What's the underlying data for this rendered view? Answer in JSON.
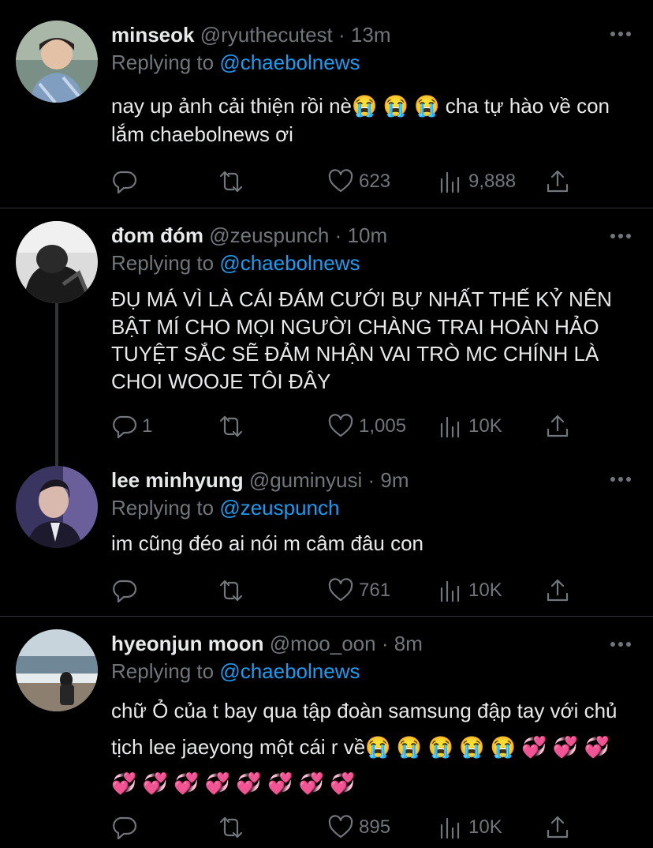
{
  "tweets": [
    {
      "name": "minseok",
      "handle": "@ryuthecutest",
      "time": "13m",
      "replying_label": "Replying to",
      "replying_to": "@chaebolnews",
      "text": "nay up ảnh cải thiện rồi nè😭 😭 😭  cha tự hào về con lắm chaebolnews ơi",
      "replies": "",
      "likes": "623",
      "views": "9,888"
    },
    {
      "name": "đom đóm",
      "handle": "@zeuspunch",
      "time": "10m",
      "replying_label": "Replying to",
      "replying_to": "@chaebolnews",
      "text": "ĐỤ MÁ VÌ LÀ CÁI ĐÁM CƯỚI BỰ NHẤT THẾ KỶ NÊN BẬT MÍ CHO MỌI NGƯỜI CHÀNG TRAI HOÀN HẢO TUYỆT SẮC SẼ ĐẢM NHẬN VAI TRÒ MC CHÍNH LÀ CHOI WOOJE TÔI ĐÂY",
      "replies": "1",
      "likes": "1,005",
      "views": "10K"
    },
    {
      "name": "lee minhyung",
      "handle": "@guminyusi",
      "time": "9m",
      "replying_label": "Replying to",
      "replying_to": "@zeuspunch",
      "text": "im cũng đéo ai nói m câm đâu con",
      "replies": "",
      "likes": "761",
      "views": "10K"
    },
    {
      "name": "hyeonjun moon",
      "handle": "@moo_oon",
      "time": "8m",
      "replying_label": "Replying to",
      "replying_to": "@chaebolnews",
      "text": "chữ Ỏ của t bay qua tập đoàn samsung đập tay với chủ tịch lee jaeyong một cái r về😭 😭 😭 😭 😭 💞 💞 💞 💞 💞 💞 💞 💞 💞 💞 💞",
      "replies": "",
      "likes": "895",
      "views": "10K"
    }
  ],
  "separator": "·",
  "colors": {
    "link": "#1d9bf0",
    "muted": "#71767b",
    "text": "#e7e9ea",
    "background": "#000000"
  },
  "icons": [
    "reply-icon",
    "retweet-icon",
    "like-icon",
    "views-icon",
    "share-icon",
    "more-icon"
  ]
}
